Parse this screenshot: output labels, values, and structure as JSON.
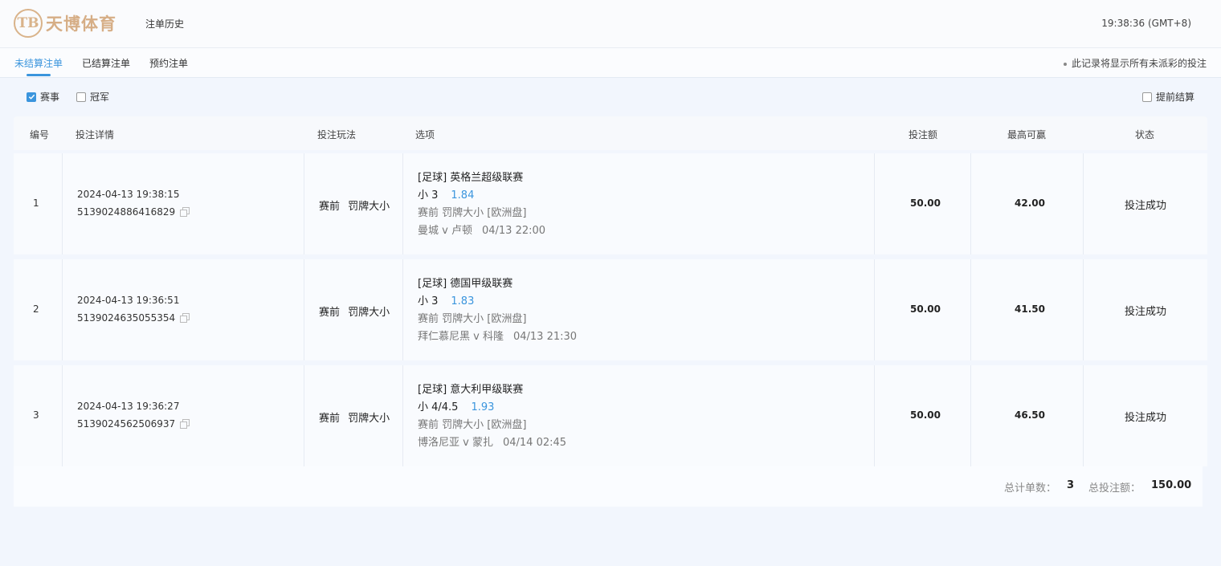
{
  "header": {
    "logo_text": "天博体育",
    "logo_mark": "TB",
    "page_title": "注单历史",
    "clock": "19:38:36 (GMT+8)"
  },
  "tabs": [
    {
      "label": "未结算注单",
      "active": true
    },
    {
      "label": "已结算注单",
      "active": false
    },
    {
      "label": "预约注单",
      "active": false
    }
  ],
  "tab_note": "此记录将显示所有未派彩的投注",
  "filters": {
    "events_label": "赛事",
    "events_checked": true,
    "outright_label": "冠军",
    "outright_checked": false,
    "cashout_label": "提前结算",
    "cashout_checked": false
  },
  "table": {
    "headers": [
      "编号",
      "投注详情",
      "投注玩法",
      "选项",
      "投注额",
      "最高可赢",
      "状态"
    ],
    "rows": [
      {
        "num": "1",
        "time": "2024-04-13 19:38:15",
        "id": "5139024886416829",
        "type": "赛前 罚牌大小",
        "league": "[足球] 英格兰超级联赛",
        "pick": "小 3",
        "odds": "1.84",
        "market": "赛前 罚牌大小 [欧洲盘]",
        "match": "曼城 v 卢顿",
        "match_time": "04/13 22:00",
        "stake": "50.00",
        "max_win": "42.00",
        "status": "投注成功"
      },
      {
        "num": "2",
        "time": "2024-04-13 19:36:51",
        "id": "5139024635055354",
        "type": "赛前 罚牌大小",
        "league": "[足球] 德国甲级联赛",
        "pick": "小 3",
        "odds": "1.83",
        "market": "赛前 罚牌大小 [欧洲盘]",
        "match": "拜仁慕尼黑 v 科隆",
        "match_time": "04/13 21:30",
        "stake": "50.00",
        "max_win": "41.50",
        "status": "投注成功"
      },
      {
        "num": "3",
        "time": "2024-04-13 19:36:27",
        "id": "5139024562506937",
        "type": "赛前 罚牌大小",
        "league": "[足球] 意大利甲级联赛",
        "pick": "小 4/4.5",
        "odds": "1.93",
        "market": "赛前 罚牌大小 [欧洲盘]",
        "match": "博洛尼亚 v 蒙扎",
        "match_time": "04/14 02:45",
        "stake": "50.00",
        "max_win": "46.50",
        "status": "投注成功"
      }
    ]
  },
  "footer": {
    "count_label": "总计单数：",
    "count_value": "3",
    "total_label": "总投注额：",
    "total_value": "150.00"
  },
  "colors": {
    "accent": "#3b95dd",
    "logo": "#d6ae86",
    "background": "#f2f6fd"
  },
  "icons": [
    "check-icon",
    "copy-icon"
  ]
}
